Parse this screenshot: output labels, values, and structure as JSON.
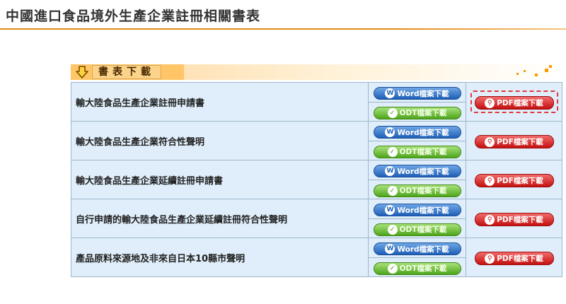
{
  "page": {
    "title": "中國進口食品境外生產企業註冊相關書表"
  },
  "panel": {
    "header_label": "書表下載"
  },
  "buttons": {
    "word_label": "Word檔案下載",
    "odt_label": "ODT檔案下載",
    "pdf_label": "PDF檔案下載"
  },
  "documents": [
    {
      "name": "輸大陸食品生產企業註冊申請書"
    },
    {
      "name": "輸大陸食品生產企業符合性聲明"
    },
    {
      "name": "輸大陸食品生產企業延續註冊申請書"
    },
    {
      "name": "自行申請的輸大陸食品生產企業延續註冊符合性聲明"
    },
    {
      "name": "產品原料來源地及非來自日本10縣市聲明"
    }
  ],
  "colors": {
    "title_rule": "#e58a16",
    "table_bg": "#dfeefa",
    "word_button": "#1f5fb5",
    "odt_button": "#4ea51c",
    "pdf_button": "#c41010"
  },
  "icons": {
    "header": "down-arrow-icon",
    "word": "word-icon",
    "odt": "odt-icon",
    "pdf": "pdf-icon"
  }
}
